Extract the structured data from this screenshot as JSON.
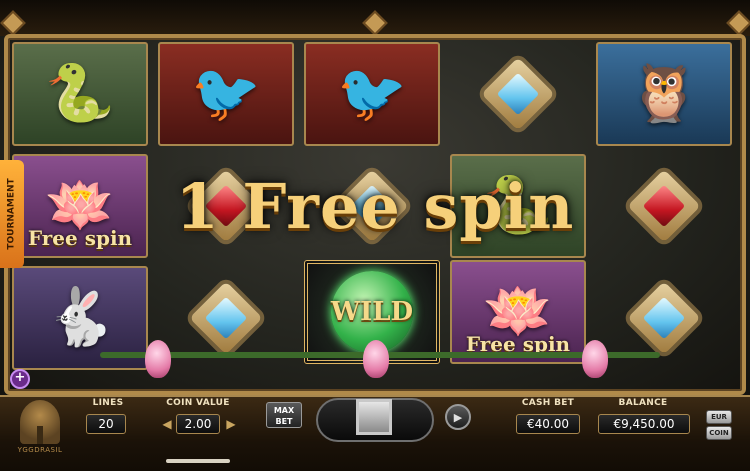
{
  "banner": {
    "text": "1 Free spin"
  },
  "side_tab": {
    "label": "TOURNAMENT"
  },
  "reels": {
    "col1": [
      {
        "symbol": "snake-symbol",
        "icon": "🐍"
      },
      {
        "symbol": "lotus-free-spin-symbol",
        "icon": "🪷",
        "caption": "Free spin"
      },
      {
        "symbol": "rabbit-symbol",
        "icon": "🐇"
      }
    ],
    "col2": [
      {
        "symbol": "phoenix-symbol",
        "icon": "🐦"
      },
      {
        "symbol": "heart-gem-symbol"
      },
      {
        "symbol": "diamond-gem-symbol"
      }
    ],
    "col3": [
      {
        "symbol": "phoenix-symbol",
        "icon": "🐦"
      },
      {
        "symbol": "diamond-gem-symbol"
      },
      {
        "symbol": "wild-symbol",
        "label": "WILD"
      }
    ],
    "col4": [
      {
        "symbol": "diamond-gem-symbol"
      },
      {
        "symbol": "snake-symbol",
        "icon": "🐍"
      },
      {
        "symbol": "lotus-free-spin-symbol",
        "icon": "🪷",
        "caption": "Free spin"
      }
    ],
    "col5": [
      {
        "symbol": "owl-symbol",
        "icon": "🦉"
      },
      {
        "symbol": "heart-gem-symbol"
      },
      {
        "symbol": "diamond-gem-symbol"
      }
    ]
  },
  "logo": {
    "text": "YGGDRASIL"
  },
  "controls": {
    "lines_label": "LINES",
    "lines_value": "20",
    "coin_value_label": "COIN VALUE",
    "coin_value": "2.00",
    "maxbet_label": "MAX BET",
    "cash_bet_label": "CASH BET",
    "cash_bet_value": "€40.00",
    "balance_label": "BALANCE",
    "balance_value": "€9,450.00",
    "eur_label": "EUR",
    "coin_label": "COIN",
    "plus_label": "+"
  },
  "colors": {
    "frame_gold": "#b08a4a",
    "banner_gold": "#f6d07a",
    "tournament_orange": "#f29a2e",
    "wild_green": "#33b24a"
  }
}
